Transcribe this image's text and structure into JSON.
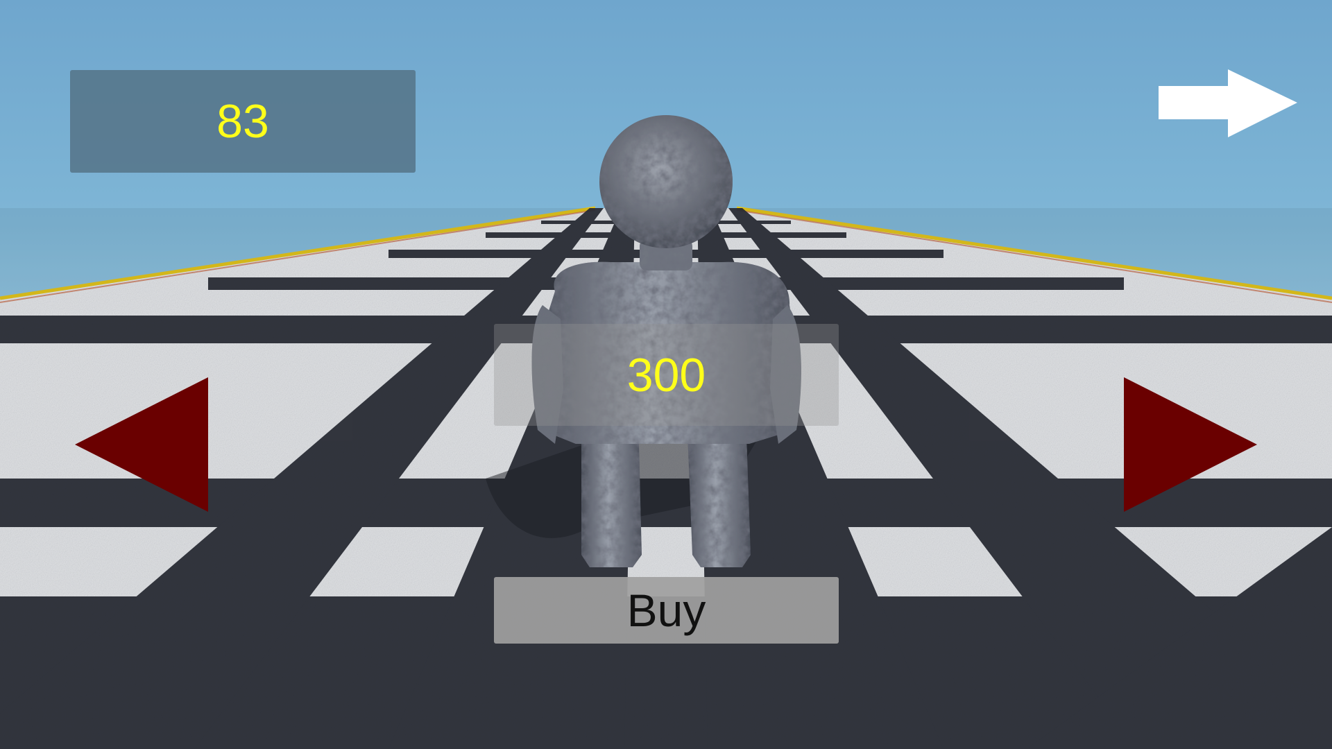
{
  "hud": {
    "coins": "83"
  },
  "shop": {
    "price": "300",
    "buy_label": "Buy"
  },
  "icons": {
    "prev": "triangle-left-icon",
    "next": "triangle-right-icon",
    "continue": "arrow-right-icon"
  },
  "colors": {
    "coin_text": "#ffff1a",
    "nav_arrow": "#6a0000",
    "continue_arrow": "#ffffff",
    "sky": "#7fb6d6"
  }
}
